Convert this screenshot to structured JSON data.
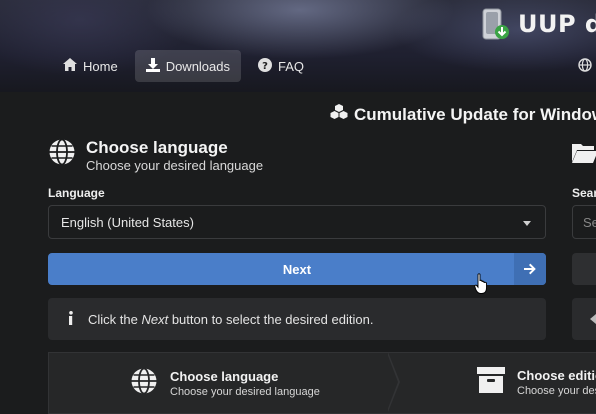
{
  "header": {
    "brand": "UUP d",
    "nav": [
      {
        "label": "Home",
        "icon": "home-icon"
      },
      {
        "label": "Downloads",
        "icon": "download-icon",
        "active": true
      },
      {
        "label": "FAQ",
        "icon": "question-circle-icon"
      }
    ]
  },
  "update_title": "Cumulative Update for Windows",
  "language_card": {
    "title": "Choose language",
    "subtitle": "Choose your desired language",
    "field_label": "Language",
    "selected": "English (United States)",
    "next_label": "Next",
    "info_prefix": "Click the ",
    "info_emph": "Next",
    "info_suffix": " button to select the desired edition."
  },
  "steps": [
    {
      "title": "Choose language",
      "subtitle": "Choose your desired language",
      "icon": "globe-icon"
    },
    {
      "title": "Choose edition",
      "subtitle": "Choose your des",
      "icon": "archive-box-icon"
    }
  ],
  "right_column": {
    "search_label": "Sear",
    "search_placeholder": "Se"
  },
  "colors": {
    "accent": "#4a7ec9",
    "background": "#1b1c1d",
    "panel": "#2a2b2d"
  }
}
